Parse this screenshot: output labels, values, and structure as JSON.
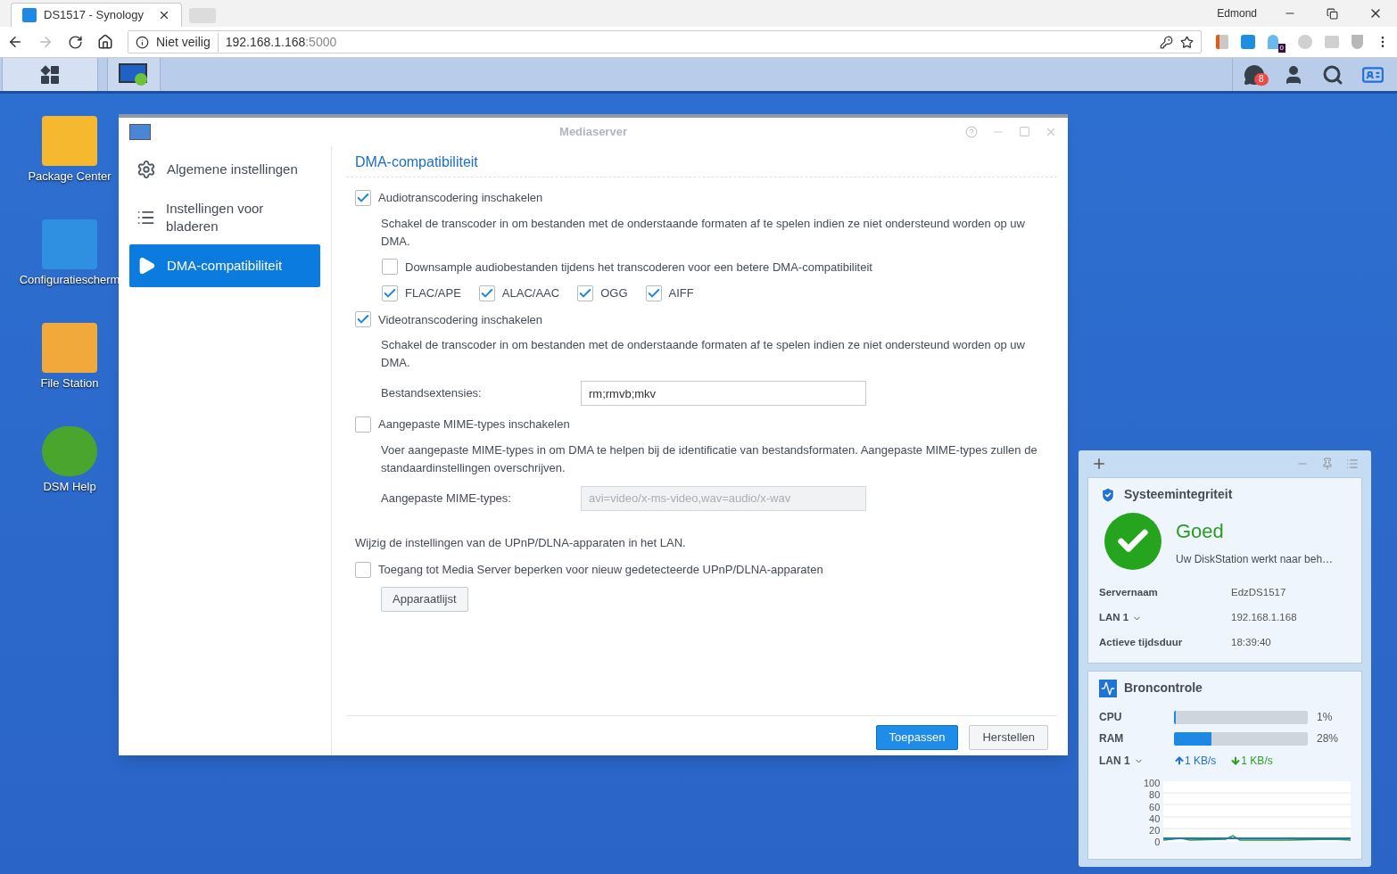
{
  "browser": {
    "tab_title": "DS1517 - Synology",
    "profile": "Edmond",
    "security": "Niet veilig",
    "url_host": "192.168.1.168",
    "url_port": ":5000",
    "extension_badge": "0"
  },
  "taskbar": {
    "notification_count": "8"
  },
  "desktop_icons": [
    {
      "label": "Package Center"
    },
    {
      "label": "Configuratiescherm"
    },
    {
      "label": "File Station"
    },
    {
      "label": "DSM Help"
    }
  ],
  "window": {
    "title": "Mediaserver",
    "sidebar": [
      {
        "label": "Algemene instellingen",
        "selected": false
      },
      {
        "label": "Instellingen voor bladeren",
        "selected": false
      },
      {
        "label": "DMA-compatibiliteit",
        "selected": true
      }
    ],
    "heading": "DMA-compatibiliteit",
    "items": [
      {
        "kind": "checkbox",
        "label": "Audiotranscodering inschakelen",
        "checked": true
      },
      {
        "kind": "description",
        "text": "Schakel de transcoder in om bestanden met de onderstaande formaten af te spelen indien ze niet ondersteund worden op uw DMA."
      },
      {
        "kind": "sub_checkbox",
        "label": "Downsample audiobestanden tijdens het transcoderen voor een betere DMA-compatibiliteit",
        "checked": false
      },
      {
        "kind": "format_row",
        "options": [
          {
            "label": "FLAC/APE",
            "checked": true
          },
          {
            "label": "ALAC/AAC",
            "checked": true
          },
          {
            "label": "OGG",
            "checked": true
          },
          {
            "label": "AIFF",
            "checked": true
          }
        ]
      },
      {
        "kind": "checkbox",
        "label": "Videotranscodering inschakelen",
        "checked": true
      },
      {
        "kind": "description",
        "text": "Schakel de transcoder in om bestanden met de onderstaande formaten af te spelen indien ze niet ondersteund worden op uw DMA."
      },
      {
        "kind": "field",
        "label": "Bestandsextensies:",
        "value": "rm;rmvb;mkv",
        "disabled": false
      },
      {
        "kind": "checkbox",
        "label": "Aangepaste MIME-types inschakelen",
        "checked": false
      },
      {
        "kind": "description",
        "text": "Voer aangepaste MIME-types in om DMA te helpen bij de identificatie van bestandsformaten. Aangepaste MIME-types zullen de standaardinstellingen overschrijven."
      },
      {
        "kind": "field",
        "label": "Aangepaste MIME-types:",
        "value": "avi=video/x-ms-video,wav=audio/x-wav",
        "disabled": true
      },
      {
        "kind": "note",
        "text": "Wijzig de instellingen van de UPnP/DLNA-apparaten in het LAN."
      },
      {
        "kind": "checkbox",
        "label": "Toegang tot Media Server beperken voor nieuw gedetecteerde UPnP/DLNA-apparaten",
        "checked": false
      },
      {
        "kind": "button",
        "label": "Apparaatlijst"
      }
    ],
    "buttons": [
      {
        "label": "Toepassen",
        "primary": true
      },
      {
        "label": "Herstellen",
        "primary": false
      }
    ]
  },
  "widget": {
    "health": {
      "title": "Systeemintegriteit",
      "status": "Goed",
      "message": "Uw DiskStation werkt naar beh…",
      "rows": [
        {
          "label": "Servernaam",
          "value": "EdzDS1517",
          "dropdown": false
        },
        {
          "label": "LAN 1",
          "value": "192.168.1.168",
          "dropdown": true
        },
        {
          "label": "Actieve tijdsduur",
          "value": "18:39:40",
          "dropdown": false
        }
      ]
    },
    "resources": {
      "title": "Broncontrole",
      "meters": [
        {
          "label": "CPU",
          "level": 0.01,
          "reading": "1%"
        },
        {
          "label": "RAM",
          "level": 0.28,
          "reading": "28%"
        }
      ],
      "network_label": "LAN 1",
      "upload": "1 KB/s",
      "download": "1 KB/s",
      "graph_labels": [
        "100",
        "80",
        "60",
        "40",
        "20",
        "0"
      ]
    }
  }
}
